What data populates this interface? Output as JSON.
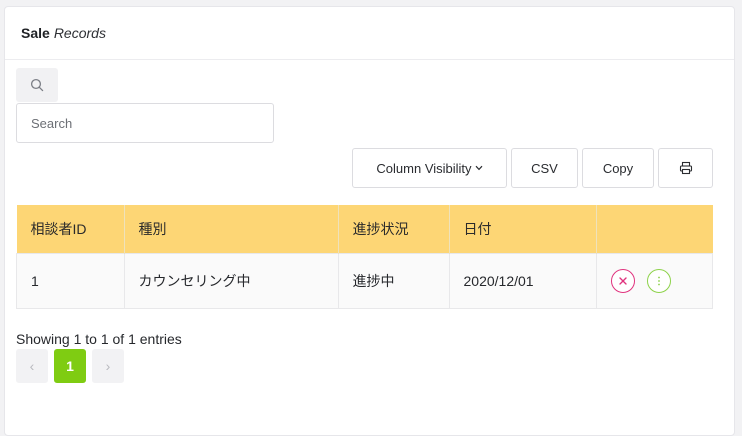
{
  "card": {
    "title_bold": "Sale",
    "title_italic": "Records"
  },
  "search": {
    "icon": "search-icon",
    "placeholder": "Search",
    "value": ""
  },
  "toolbar": {
    "column_visibility_label": "Column Visibility",
    "column_visibility_caret": "⌄",
    "csv_label": "CSV",
    "copy_label": "Copy",
    "print_icon": "printer-icon"
  },
  "table": {
    "columns": [
      "相談者ID",
      "種別",
      "進捗状況",
      "日付",
      ""
    ],
    "rows": [
      {
        "id": "1",
        "type": "カウンセリング中",
        "status": "進捗中",
        "date": "2020/12/01",
        "actions": [
          "delete-icon",
          "more-icon"
        ]
      }
    ]
  },
  "footer": {
    "info": "Showing 1 to 1 of 1 entries",
    "pagination": {
      "prev": "‹",
      "current": "1",
      "next": "›"
    }
  },
  "colors": {
    "header_bg": "#fdd675",
    "delete": "#e0337e",
    "more": "#8dd24a",
    "page_active": "#7fcc12"
  }
}
